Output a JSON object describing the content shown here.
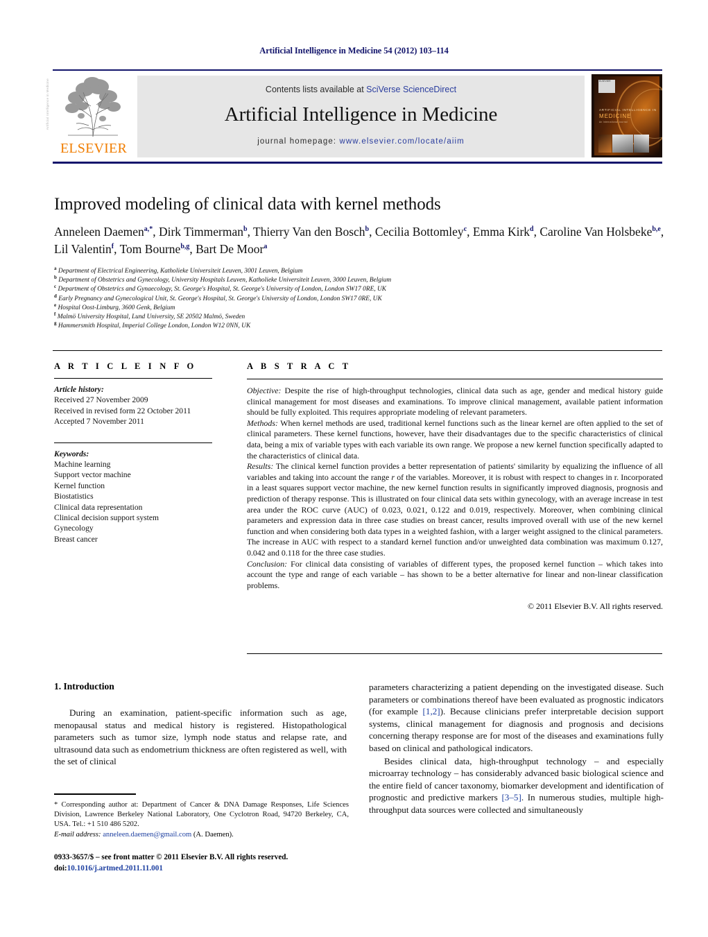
{
  "running_head": "Artificial Intelligence in Medicine 54 (2012) 103–114",
  "masthead": {
    "contents_prefix": "Contents lists available at ",
    "contents_link": "SciVerse ScienceDirect",
    "journal_title": "Artificial Intelligence in Medicine",
    "homepage_prefix": "journal homepage: ",
    "homepage_url": "www.elsevier.com/locate/aiim",
    "publisher": "ELSEVIER",
    "side_strip": "Artificial Intelligence in Medicine",
    "cover": {
      "badge": "ELSEVIER",
      "line1": "ARTIFICIAL INTELLIGENCE IN",
      "line2": "MEDICINE",
      "line3": "An International Journal"
    },
    "accent_blue": "#2a3d9e",
    "accent_orange": "#f07d00"
  },
  "article": {
    "title": "Improved modeling of clinical data with kernel methods",
    "authors": [
      {
        "name": "Anneleen Daemen",
        "marks": "a,*",
        "sep": ", "
      },
      {
        "name": "Dirk Timmerman",
        "marks": "b",
        "sep": ", "
      },
      {
        "name": "Thierry Van den Bosch",
        "marks": "b",
        "sep": ", "
      },
      {
        "name": "Cecilia Bottomley",
        "marks": "c",
        "sep": ", "
      },
      {
        "name": "Emma Kirk",
        "marks": "d",
        "sep": ", "
      },
      {
        "name": "Caroline Van Holsbeke",
        "marks": "b,e",
        "sep": ", "
      },
      {
        "name": "Lil Valentin",
        "marks": "f",
        "sep": ", "
      },
      {
        "name": "Tom Bourne",
        "marks": "b,g",
        "sep": ", "
      },
      {
        "name": "Bart De Moor",
        "marks": "a",
        "sep": ""
      }
    ],
    "affiliations": [
      {
        "mark": "a",
        "text": "Department of Electrical Engineering, Katholieke Universiteit Leuven, 3001 Leuven, Belgium"
      },
      {
        "mark": "b",
        "text": "Department of Obstetrics and Gynecology, University Hospitals Leuven, Katholieke Universiteit Leuven, 3000 Leuven, Belgium"
      },
      {
        "mark": "c",
        "text": "Department of Obstetrics and Gynaecology, St. George's Hospital, St. George's University of London, London SW17 0RE, UK"
      },
      {
        "mark": "d",
        "text": "Early Pregnancy and Gynecological Unit, St. George's Hospital, St. George's University of London, London SW17 0RE, UK"
      },
      {
        "mark": "e",
        "text": "Hospital Oost-Limburg, 3600 Genk, Belgium"
      },
      {
        "mark": "f",
        "text": "Malmö University Hospital, Lund University, SE 20502 Malmö, Sweden"
      },
      {
        "mark": "g",
        "text": "Hammersmith Hospital, Imperial College London, London W12 0NN, UK"
      }
    ]
  },
  "article_info": {
    "heading": "A R T I C L E   I N F O",
    "history_label": "Article history:",
    "history": [
      "Received 27 November 2009",
      "Received in revised form 22 October 2011",
      "Accepted 7 November 2011"
    ],
    "keywords_label": "Keywords:",
    "keywords": [
      "Machine learning",
      "Support vector machine",
      "Kernel function",
      "Biostatistics",
      "Clinical data representation",
      "Clinical decision support system",
      "Gynecology",
      "Breast cancer"
    ]
  },
  "abstract": {
    "heading": "A B S T R A C T",
    "sections": [
      {
        "label": "Objective:",
        "text": " Despite the rise of high-throughput technologies, clinical data such as age, gender and medical history guide clinical management for most diseases and examinations. To improve clinical management, available patient information should be fully exploited. This requires appropriate modeling of relevant parameters."
      },
      {
        "label": "Methods:",
        "text": " When kernel methods are used, traditional kernel functions such as the linear kernel are often applied to the set of clinical parameters. These kernel functions, however, have their disadvantages due to the specific characteristics of clinical data, being a mix of variable types with each variable its own range. We propose a new kernel function specifically adapted to the characteristics of clinical data."
      },
      {
        "label": "Results:",
        "text_before_r": " The clinical kernel function provides a better representation of patients' similarity by equalizing the influence of all variables and taking into account the range ",
        "r_italic": "r",
        "text_after_r": " of the variables. Moreover, it is robust with respect to changes in r. Incorporated in a least squares support vector machine, the new kernel function results in significantly improved diagnosis, prognosis and prediction of therapy response. This is illustrated on four clinical data sets within gynecology, with an average increase in test area under the ROC curve (AUC) of 0.023, 0.021, 0.122 and 0.019, respectively. Moreover, when combining clinical parameters and expression data in three case studies on breast cancer, results improved overall with use of the new kernel function and when considering both data types in a weighted fashion, with a larger weight assigned to the clinical parameters. The increase in AUC with respect to a standard kernel function and/or unweighted data combination was maximum 0.127, 0.042 and 0.118 for the three case studies."
      },
      {
        "label": "Conclusion:",
        "text": " For clinical data consisting of variables of different types, the proposed kernel function – which takes into account the type and range of each variable – has shown to be a better alternative for linear and non-linear classification problems."
      }
    ],
    "copyright": "© 2011 Elsevier B.V. All rights reserved."
  },
  "body": {
    "section_number_title": "1.  Introduction",
    "left_paragraphs": [
      "During an examination, patient-specific information such as age, menopausal status and medical history is registered. Histopathological parameters such as tumor size, lymph node status and relapse rate, and ultrasound data such as endometrium thickness are often registered as well, with the set of clinical"
    ],
    "right_paragraph_1_a": "parameters characterizing a patient depending on the investigated disease. Such parameters or combinations thereof have been evaluated as prognostic indicators (for example ",
    "right_paragraph_1_ref": "[1,2]",
    "right_paragraph_1_b": "). Because clinicians prefer interpretable decision support systems, clinical management for diagnosis and prognosis and decisions concerning therapy response are for most of the diseases and examinations fully based on clinical and pathological indicators.",
    "right_paragraph_2_a": "Besides clinical data, high-throughput technology – and especially microarray technology – has considerably advanced basic biological science and the entire field of cancer taxonomy, biomarker development and identification of prognostic and predictive markers ",
    "right_paragraph_2_ref": "[3–5]",
    "right_paragraph_2_b": ". In numerous studies, multiple high-throughput data sources were collected and simultaneously"
  },
  "footnotes": {
    "corresponding": "* Corresponding author at: Department of Cancer & DNA Damage Responses, Life Sciences Division, Lawrence Berkeley National Laboratory, One Cyclotron Road, 94720 Berkeley, CA, USA. Tel.: +1 510 486 5202.",
    "email_label": "E-mail address:",
    "email_address": "anneleen.daemen@gmail.com",
    "email_suffix": " (A. Daemen).",
    "issn_line": "0933-3657/$ – see front matter © 2011 Elsevier B.V. All rights reserved.",
    "doi_label": "doi:",
    "doi_value": "10.1016/j.artmed.2011.11.001"
  }
}
